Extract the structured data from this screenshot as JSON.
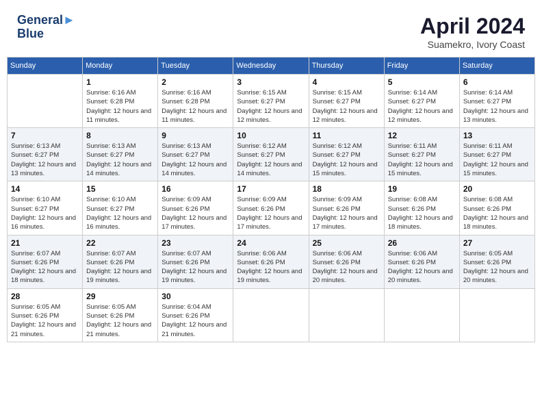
{
  "header": {
    "logo_line1": "General",
    "logo_line2": "Blue",
    "month": "April 2024",
    "location": "Suamekro, Ivory Coast"
  },
  "days_of_week": [
    "Sunday",
    "Monday",
    "Tuesday",
    "Wednesday",
    "Thursday",
    "Friday",
    "Saturday"
  ],
  "weeks": [
    [
      {
        "day": "",
        "info": ""
      },
      {
        "day": "1",
        "info": "Sunrise: 6:16 AM\nSunset: 6:28 PM\nDaylight: 12 hours\nand 11 minutes."
      },
      {
        "day": "2",
        "info": "Sunrise: 6:16 AM\nSunset: 6:28 PM\nDaylight: 12 hours\nand 11 minutes."
      },
      {
        "day": "3",
        "info": "Sunrise: 6:15 AM\nSunset: 6:27 PM\nDaylight: 12 hours\nand 12 minutes."
      },
      {
        "day": "4",
        "info": "Sunrise: 6:15 AM\nSunset: 6:27 PM\nDaylight: 12 hours\nand 12 minutes."
      },
      {
        "day": "5",
        "info": "Sunrise: 6:14 AM\nSunset: 6:27 PM\nDaylight: 12 hours\nand 12 minutes."
      },
      {
        "day": "6",
        "info": "Sunrise: 6:14 AM\nSunset: 6:27 PM\nDaylight: 12 hours\nand 13 minutes."
      }
    ],
    [
      {
        "day": "7",
        "info": "Sunrise: 6:13 AM\nSunset: 6:27 PM\nDaylight: 12 hours\nand 13 minutes."
      },
      {
        "day": "8",
        "info": "Sunrise: 6:13 AM\nSunset: 6:27 PM\nDaylight: 12 hours\nand 14 minutes."
      },
      {
        "day": "9",
        "info": "Sunrise: 6:13 AM\nSunset: 6:27 PM\nDaylight: 12 hours\nand 14 minutes."
      },
      {
        "day": "10",
        "info": "Sunrise: 6:12 AM\nSunset: 6:27 PM\nDaylight: 12 hours\nand 14 minutes."
      },
      {
        "day": "11",
        "info": "Sunrise: 6:12 AM\nSunset: 6:27 PM\nDaylight: 12 hours\nand 15 minutes."
      },
      {
        "day": "12",
        "info": "Sunrise: 6:11 AM\nSunset: 6:27 PM\nDaylight: 12 hours\nand 15 minutes."
      },
      {
        "day": "13",
        "info": "Sunrise: 6:11 AM\nSunset: 6:27 PM\nDaylight: 12 hours\nand 15 minutes."
      }
    ],
    [
      {
        "day": "14",
        "info": "Sunrise: 6:10 AM\nSunset: 6:27 PM\nDaylight: 12 hours\nand 16 minutes."
      },
      {
        "day": "15",
        "info": "Sunrise: 6:10 AM\nSunset: 6:27 PM\nDaylight: 12 hours\nand 16 minutes."
      },
      {
        "day": "16",
        "info": "Sunrise: 6:09 AM\nSunset: 6:26 PM\nDaylight: 12 hours\nand 17 minutes."
      },
      {
        "day": "17",
        "info": "Sunrise: 6:09 AM\nSunset: 6:26 PM\nDaylight: 12 hours\nand 17 minutes."
      },
      {
        "day": "18",
        "info": "Sunrise: 6:09 AM\nSunset: 6:26 PM\nDaylight: 12 hours\nand 17 minutes."
      },
      {
        "day": "19",
        "info": "Sunrise: 6:08 AM\nSunset: 6:26 PM\nDaylight: 12 hours\nand 18 minutes."
      },
      {
        "day": "20",
        "info": "Sunrise: 6:08 AM\nSunset: 6:26 PM\nDaylight: 12 hours\nand 18 minutes."
      }
    ],
    [
      {
        "day": "21",
        "info": "Sunrise: 6:07 AM\nSunset: 6:26 PM\nDaylight: 12 hours\nand 18 minutes."
      },
      {
        "day": "22",
        "info": "Sunrise: 6:07 AM\nSunset: 6:26 PM\nDaylight: 12 hours\nand 19 minutes."
      },
      {
        "day": "23",
        "info": "Sunrise: 6:07 AM\nSunset: 6:26 PM\nDaylight: 12 hours\nand 19 minutes."
      },
      {
        "day": "24",
        "info": "Sunrise: 6:06 AM\nSunset: 6:26 PM\nDaylight: 12 hours\nand 19 minutes."
      },
      {
        "day": "25",
        "info": "Sunrise: 6:06 AM\nSunset: 6:26 PM\nDaylight: 12 hours\nand 20 minutes."
      },
      {
        "day": "26",
        "info": "Sunrise: 6:06 AM\nSunset: 6:26 PM\nDaylight: 12 hours\nand 20 minutes."
      },
      {
        "day": "27",
        "info": "Sunrise: 6:05 AM\nSunset: 6:26 PM\nDaylight: 12 hours\nand 20 minutes."
      }
    ],
    [
      {
        "day": "28",
        "info": "Sunrise: 6:05 AM\nSunset: 6:26 PM\nDaylight: 12 hours\nand 21 minutes."
      },
      {
        "day": "29",
        "info": "Sunrise: 6:05 AM\nSunset: 6:26 PM\nDaylight: 12 hours\nand 21 minutes."
      },
      {
        "day": "30",
        "info": "Sunrise: 6:04 AM\nSunset: 6:26 PM\nDaylight: 12 hours\nand 21 minutes."
      },
      {
        "day": "",
        "info": ""
      },
      {
        "day": "",
        "info": ""
      },
      {
        "day": "",
        "info": ""
      },
      {
        "day": "",
        "info": ""
      }
    ]
  ]
}
